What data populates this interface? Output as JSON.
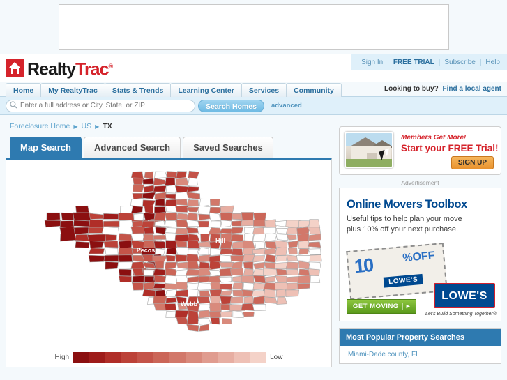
{
  "top_ad": {
    "present": true
  },
  "brand": {
    "name_part1": "Realty",
    "name_part2": "Trac",
    "tm": "®",
    "logo_icon": "house-icon"
  },
  "utility": {
    "sign_in": "Sign In",
    "free_trial": "FREE TRIAL",
    "subscribe": "Subscribe",
    "help": "Help",
    "separator": "|"
  },
  "nav": {
    "items": [
      {
        "label": "Home"
      },
      {
        "label": "My RealtyTrac"
      },
      {
        "label": "Stats & Trends"
      },
      {
        "label": "Learning Center"
      },
      {
        "label": "Services"
      },
      {
        "label": "Community"
      }
    ],
    "right_question": "Looking to buy?",
    "right_link": "Find a local agent"
  },
  "search": {
    "icon": "search-icon",
    "placeholder": "Enter a full address or City, State, or ZIP",
    "value": "",
    "button_label": "Search Homes",
    "advanced_label": "advanced"
  },
  "breadcrumb": {
    "home": "Foreclosure Home",
    "country": "US",
    "state": "TX",
    "arrow": "▶"
  },
  "tabs": [
    {
      "label": "Map Search",
      "active": true
    },
    {
      "label": "Advanced Search",
      "active": false
    },
    {
      "label": "Saved Searches",
      "active": false
    }
  ],
  "map": {
    "state": "TX",
    "county_labels": [
      "Hill",
      "Pecos",
      "Webb"
    ],
    "legend_high": "High",
    "legend_low": "Low",
    "legend_colors": [
      "#8b0f10",
      "#9e1c1a",
      "#b02e28",
      "#bc4238",
      "#c45449",
      "#cb6658",
      "#d2786a",
      "#d98a7c",
      "#e09c8f",
      "#e7aea2",
      "#eec0b5",
      "#f4d2c8"
    ]
  },
  "promo": {
    "line1": "Members Get More!",
    "line2": "Start your FREE Trial!",
    "button_label": "SIGN UP",
    "photo_icon": "house-photo",
    "cursor_icon": "cursor-arrow-icon"
  },
  "advertisement": {
    "label": "Advertisement",
    "headline": "Online Movers Toolbox",
    "sub_line1": "Useful tips to help plan your move",
    "sub_line2": "plus 10% off your next purchase.",
    "coupon_amount": "10",
    "coupon_percent": "%",
    "coupon_off": "OFF",
    "coupon_brand": "LOWE'S",
    "cta_label": "GET MOVING",
    "cta_arrow": "▸",
    "brand": "LOWE'S",
    "brand_tagline": "Let's Build Something Together®"
  },
  "popular": {
    "title": "Most Popular Property Searches",
    "items": [
      {
        "label": "Miami-Dade county, FL"
      }
    ]
  },
  "colors": {
    "accent_blue": "#2e7ab0",
    "brand_red": "#d5232b",
    "light_blue_bg": "#dff0fa",
    "page_bg": "#f4f9fc"
  }
}
